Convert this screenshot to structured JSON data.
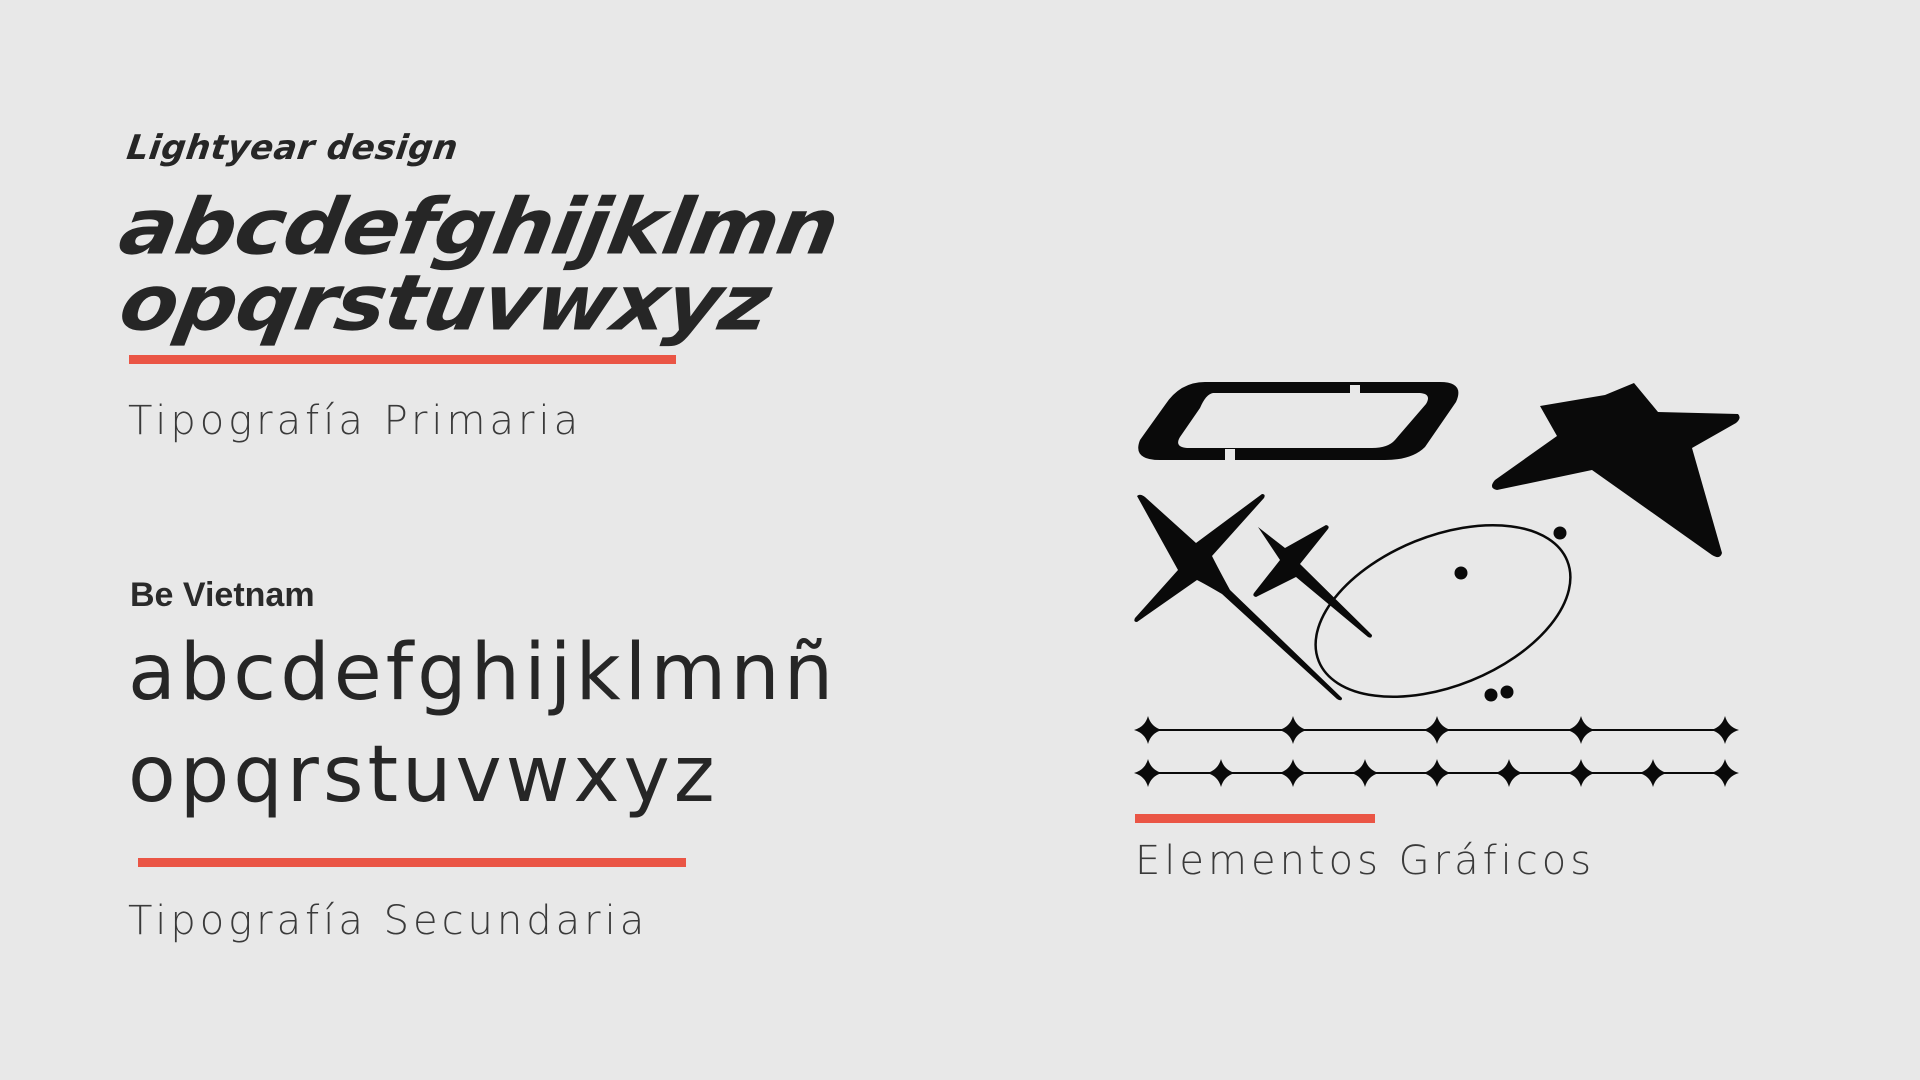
{
  "primary_typography": {
    "font_name": "Lightyear design",
    "alphabet_line1": "abcdefghijklmn",
    "alphabet_line2": "opqrstuvwxyz",
    "caption": "Tipografía Primaria"
  },
  "secondary_typography": {
    "font_name": "Be Vietnam",
    "alphabet_line1": "abcdefghijklmnñ",
    "alphabet_line2": "opqrstuvwxyz",
    "caption": "Tipografía Secundaria"
  },
  "graphic_elements": {
    "caption": "Elementos Gráficos",
    "icons": [
      "pill-badge-icon",
      "star-icon",
      "large-sparkle-icon",
      "small-sparkle-icon",
      "orbit-ellipse-icon",
      "sparkle-divider-icon"
    ]
  },
  "colors": {
    "background": "#e8e8e8",
    "text": "#262626",
    "accent": "#ea5545",
    "shape": "#0a0a0a"
  }
}
